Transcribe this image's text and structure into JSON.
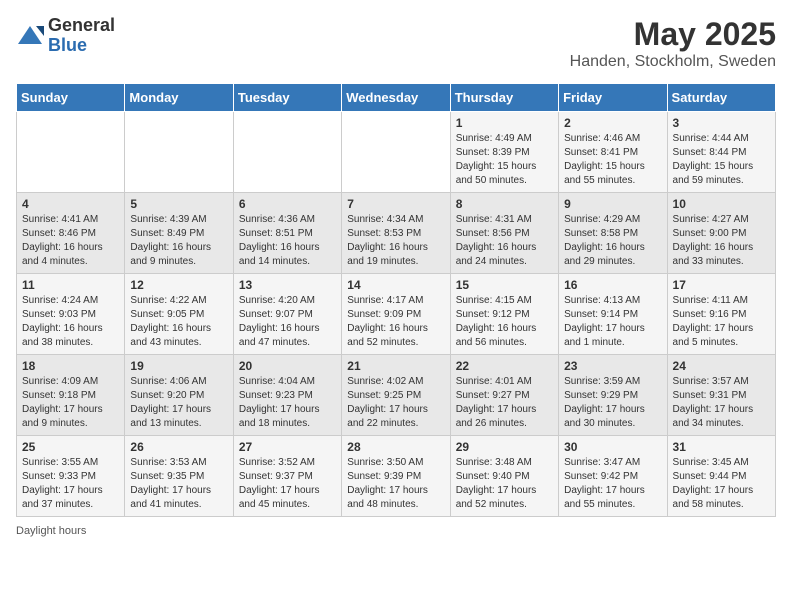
{
  "header": {
    "logo_general": "General",
    "logo_blue": "Blue",
    "month_title": "May 2025",
    "location": "Handen, Stockholm, Sweden"
  },
  "weekdays": [
    "Sunday",
    "Monday",
    "Tuesday",
    "Wednesday",
    "Thursday",
    "Friday",
    "Saturday"
  ],
  "weeks": [
    [
      {
        "day": "",
        "content": ""
      },
      {
        "day": "",
        "content": ""
      },
      {
        "day": "",
        "content": ""
      },
      {
        "day": "",
        "content": ""
      },
      {
        "day": "1",
        "content": "Sunrise: 4:49 AM\nSunset: 8:39 PM\nDaylight: 15 hours\nand 50 minutes."
      },
      {
        "day": "2",
        "content": "Sunrise: 4:46 AM\nSunset: 8:41 PM\nDaylight: 15 hours\nand 55 minutes."
      },
      {
        "day": "3",
        "content": "Sunrise: 4:44 AM\nSunset: 8:44 PM\nDaylight: 15 hours\nand 59 minutes."
      }
    ],
    [
      {
        "day": "4",
        "content": "Sunrise: 4:41 AM\nSunset: 8:46 PM\nDaylight: 16 hours\nand 4 minutes."
      },
      {
        "day": "5",
        "content": "Sunrise: 4:39 AM\nSunset: 8:49 PM\nDaylight: 16 hours\nand 9 minutes."
      },
      {
        "day": "6",
        "content": "Sunrise: 4:36 AM\nSunset: 8:51 PM\nDaylight: 16 hours\nand 14 minutes."
      },
      {
        "day": "7",
        "content": "Sunrise: 4:34 AM\nSunset: 8:53 PM\nDaylight: 16 hours\nand 19 minutes."
      },
      {
        "day": "8",
        "content": "Sunrise: 4:31 AM\nSunset: 8:56 PM\nDaylight: 16 hours\nand 24 minutes."
      },
      {
        "day": "9",
        "content": "Sunrise: 4:29 AM\nSunset: 8:58 PM\nDaylight: 16 hours\nand 29 minutes."
      },
      {
        "day": "10",
        "content": "Sunrise: 4:27 AM\nSunset: 9:00 PM\nDaylight: 16 hours\nand 33 minutes."
      }
    ],
    [
      {
        "day": "11",
        "content": "Sunrise: 4:24 AM\nSunset: 9:03 PM\nDaylight: 16 hours\nand 38 minutes."
      },
      {
        "day": "12",
        "content": "Sunrise: 4:22 AM\nSunset: 9:05 PM\nDaylight: 16 hours\nand 43 minutes."
      },
      {
        "day": "13",
        "content": "Sunrise: 4:20 AM\nSunset: 9:07 PM\nDaylight: 16 hours\nand 47 minutes."
      },
      {
        "day": "14",
        "content": "Sunrise: 4:17 AM\nSunset: 9:09 PM\nDaylight: 16 hours\nand 52 minutes."
      },
      {
        "day": "15",
        "content": "Sunrise: 4:15 AM\nSunset: 9:12 PM\nDaylight: 16 hours\nand 56 minutes."
      },
      {
        "day": "16",
        "content": "Sunrise: 4:13 AM\nSunset: 9:14 PM\nDaylight: 17 hours\nand 1 minute."
      },
      {
        "day": "17",
        "content": "Sunrise: 4:11 AM\nSunset: 9:16 PM\nDaylight: 17 hours\nand 5 minutes."
      }
    ],
    [
      {
        "day": "18",
        "content": "Sunrise: 4:09 AM\nSunset: 9:18 PM\nDaylight: 17 hours\nand 9 minutes."
      },
      {
        "day": "19",
        "content": "Sunrise: 4:06 AM\nSunset: 9:20 PM\nDaylight: 17 hours\nand 13 minutes."
      },
      {
        "day": "20",
        "content": "Sunrise: 4:04 AM\nSunset: 9:23 PM\nDaylight: 17 hours\nand 18 minutes."
      },
      {
        "day": "21",
        "content": "Sunrise: 4:02 AM\nSunset: 9:25 PM\nDaylight: 17 hours\nand 22 minutes."
      },
      {
        "day": "22",
        "content": "Sunrise: 4:01 AM\nSunset: 9:27 PM\nDaylight: 17 hours\nand 26 minutes."
      },
      {
        "day": "23",
        "content": "Sunrise: 3:59 AM\nSunset: 9:29 PM\nDaylight: 17 hours\nand 30 minutes."
      },
      {
        "day": "24",
        "content": "Sunrise: 3:57 AM\nSunset: 9:31 PM\nDaylight: 17 hours\nand 34 minutes."
      }
    ],
    [
      {
        "day": "25",
        "content": "Sunrise: 3:55 AM\nSunset: 9:33 PM\nDaylight: 17 hours\nand 37 minutes."
      },
      {
        "day": "26",
        "content": "Sunrise: 3:53 AM\nSunset: 9:35 PM\nDaylight: 17 hours\nand 41 minutes."
      },
      {
        "day": "27",
        "content": "Sunrise: 3:52 AM\nSunset: 9:37 PM\nDaylight: 17 hours\nand 45 minutes."
      },
      {
        "day": "28",
        "content": "Sunrise: 3:50 AM\nSunset: 9:39 PM\nDaylight: 17 hours\nand 48 minutes."
      },
      {
        "day": "29",
        "content": "Sunrise: 3:48 AM\nSunset: 9:40 PM\nDaylight: 17 hours\nand 52 minutes."
      },
      {
        "day": "30",
        "content": "Sunrise: 3:47 AM\nSunset: 9:42 PM\nDaylight: 17 hours\nand 55 minutes."
      },
      {
        "day": "31",
        "content": "Sunrise: 3:45 AM\nSunset: 9:44 PM\nDaylight: 17 hours\nand 58 minutes."
      }
    ]
  ],
  "legend": {
    "daylight_label": "Daylight hours"
  }
}
